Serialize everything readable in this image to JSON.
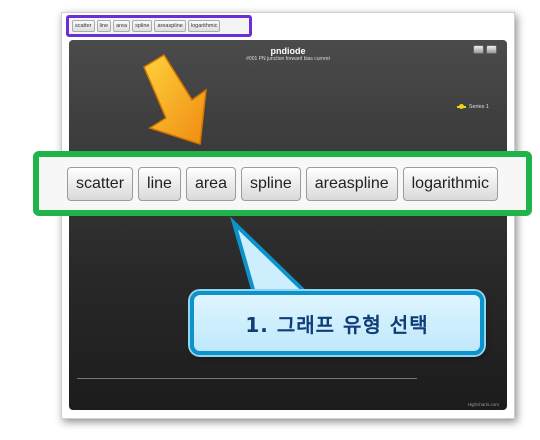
{
  "toolbar": {
    "buttons": [
      "scatter",
      "line",
      "area",
      "spline",
      "areaspline",
      "logarithmic"
    ]
  },
  "chart": {
    "title": "pndiode",
    "subtitle": "#001 PN junction forward bias current",
    "legend_label": "Series 1",
    "credits": "Highcharts.com"
  },
  "callout": {
    "text": "1. 그래프 유형 선택"
  },
  "colors": {
    "toolbar_highlight": "#6a2fd6",
    "zoom_highlight": "#1fb34a",
    "arrow": "#f5a21b",
    "callout_border": "#0d93c9",
    "series": "#f2d21b"
  },
  "icons": [
    "print-icon",
    "export-icon",
    "arrow-down-icon",
    "legend-marker"
  ]
}
